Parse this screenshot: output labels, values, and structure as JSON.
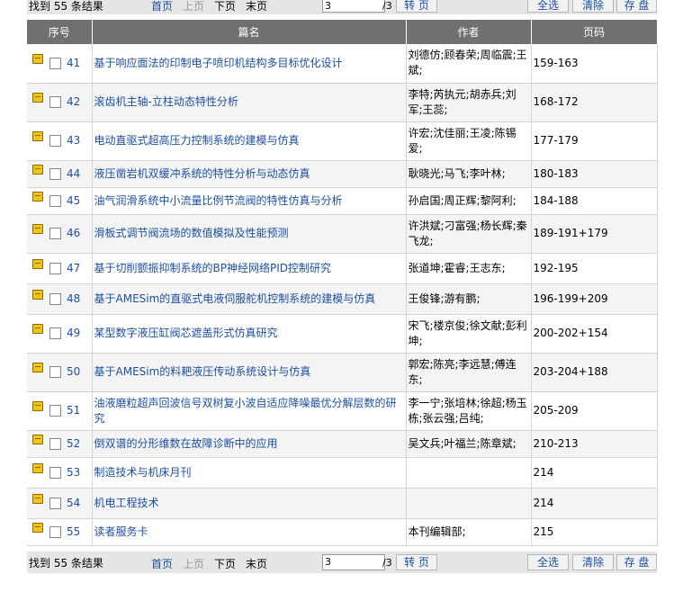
{
  "toolbar": {
    "found": "找到 55 条结果",
    "first": "首页",
    "prev": "上页",
    "next": "下页",
    "last": "末页",
    "page_value": "3",
    "total_pages": "/3",
    "go": "转 页",
    "select_all": "全选",
    "clear": "清除",
    "save": "存 盘"
  },
  "table": {
    "headers": [
      "序号",
      "篇名",
      "作者",
      "页码"
    ],
    "rows": [
      {
        "no": "41",
        "title": "基于响应面法的印制电子喷印机结构多目标优化设计",
        "author": "刘德仿;顾春荣;周临震;王斌;",
        "pages": "159-163"
      },
      {
        "no": "42",
        "title": "滚齿机主轴-立柱动态特性分析",
        "author": "李特;芮执元;胡赤兵;刘军;王蕊;",
        "pages": "168-172"
      },
      {
        "no": "43",
        "title": "电动直驱式超高压力控制系统的建模与仿真",
        "author": "许宏;沈佳丽;王凌;陈锡爱;",
        "pages": "177-179"
      },
      {
        "no": "44",
        "title": "液压凿岩机双缓冲系统的特性分析与动态仿真",
        "author": "耿晓光;马飞;李叶林;",
        "pages": "180-183"
      },
      {
        "no": "45",
        "title": "油气润滑系统中小流量比例节流阀的特性仿真与分析",
        "author": "孙启国;周正辉;黎阿利;",
        "pages": "184-188"
      },
      {
        "no": "46",
        "title": "滑板式调节阀流场的数值模拟及性能预测",
        "author": "许洪斌;刁富强;杨长辉;秦飞龙;",
        "pages": "189-191+179"
      },
      {
        "no": "47",
        "title": "基于切削颤振抑制系统的BP神经网络PID控制研究",
        "author": "张道坤;霍睿;王志东;",
        "pages": "192-195"
      },
      {
        "no": "48",
        "title": "基于AMESim的直驱式电液伺服舵机控制系统的建模与仿真",
        "author": "王俊锋;游有鹏;",
        "pages": "196-199+209"
      },
      {
        "no": "49",
        "title": "某型数字液压缸阀芯遮盖形式仿真研究",
        "author": "宋飞;楼京俊;徐文献;彭利坤;",
        "pages": "200-202+154"
      },
      {
        "no": "50",
        "title": "基于AMESim的料耙液压传动系统设计与仿真",
        "author": "郭宏;陈亮;李远慧;傅连东;",
        "pages": "203-204+188"
      },
      {
        "no": "51",
        "title": "油液磨粒超声回波信号双树复小波自适应降噪最优分解层数的研究",
        "author": "李一宁;张培林;徐超;杨玉栋;张云强;吕纯;",
        "pages": "205-209"
      },
      {
        "no": "52",
        "title": "倒双谱的分形维数在故障诊断中的应用",
        "author": "吴文兵;叶福兰;陈章斌;",
        "pages": "210-213"
      },
      {
        "no": "53",
        "title": "制造技术与机床月刊",
        "author": "",
        "pages": "214"
      },
      {
        "no": "54",
        "title": "机电工程技术",
        "author": "",
        "pages": "214"
      },
      {
        "no": "55",
        "title": "读者服务卡",
        "author": "本刊编辑部;",
        "pages": "215"
      }
    ]
  }
}
